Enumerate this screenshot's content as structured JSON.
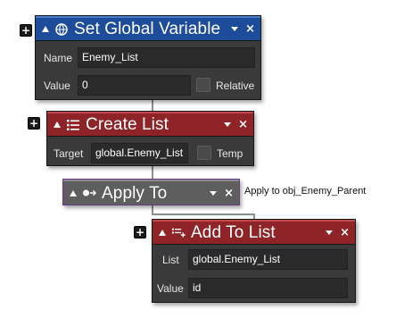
{
  "set_global": {
    "title": "Set Global Variable",
    "name_label": "Name",
    "name_value": "Enemy_List",
    "value_label": "Value",
    "value_value": "0",
    "relative_label": "Relative"
  },
  "create_list": {
    "title": "Create List",
    "target_label": "Target",
    "target_value": "global.Enemy_List",
    "temp_label": "Temp"
  },
  "apply_to": {
    "title": "Apply To",
    "note": "Apply to obj_Enemy_Parent"
  },
  "add_to_list": {
    "title": "Add To List",
    "list_label": "List",
    "list_value": "global.Enemy_List",
    "value_label": "Value",
    "value_value": "id"
  },
  "icons": {
    "plus": "+",
    "close": "×"
  },
  "colors": {
    "blue_header": "#1d4d9a",
    "red_header": "#8e2428",
    "gray_header": "#5e5e5e",
    "panel_body": "#3a3a3a"
  }
}
